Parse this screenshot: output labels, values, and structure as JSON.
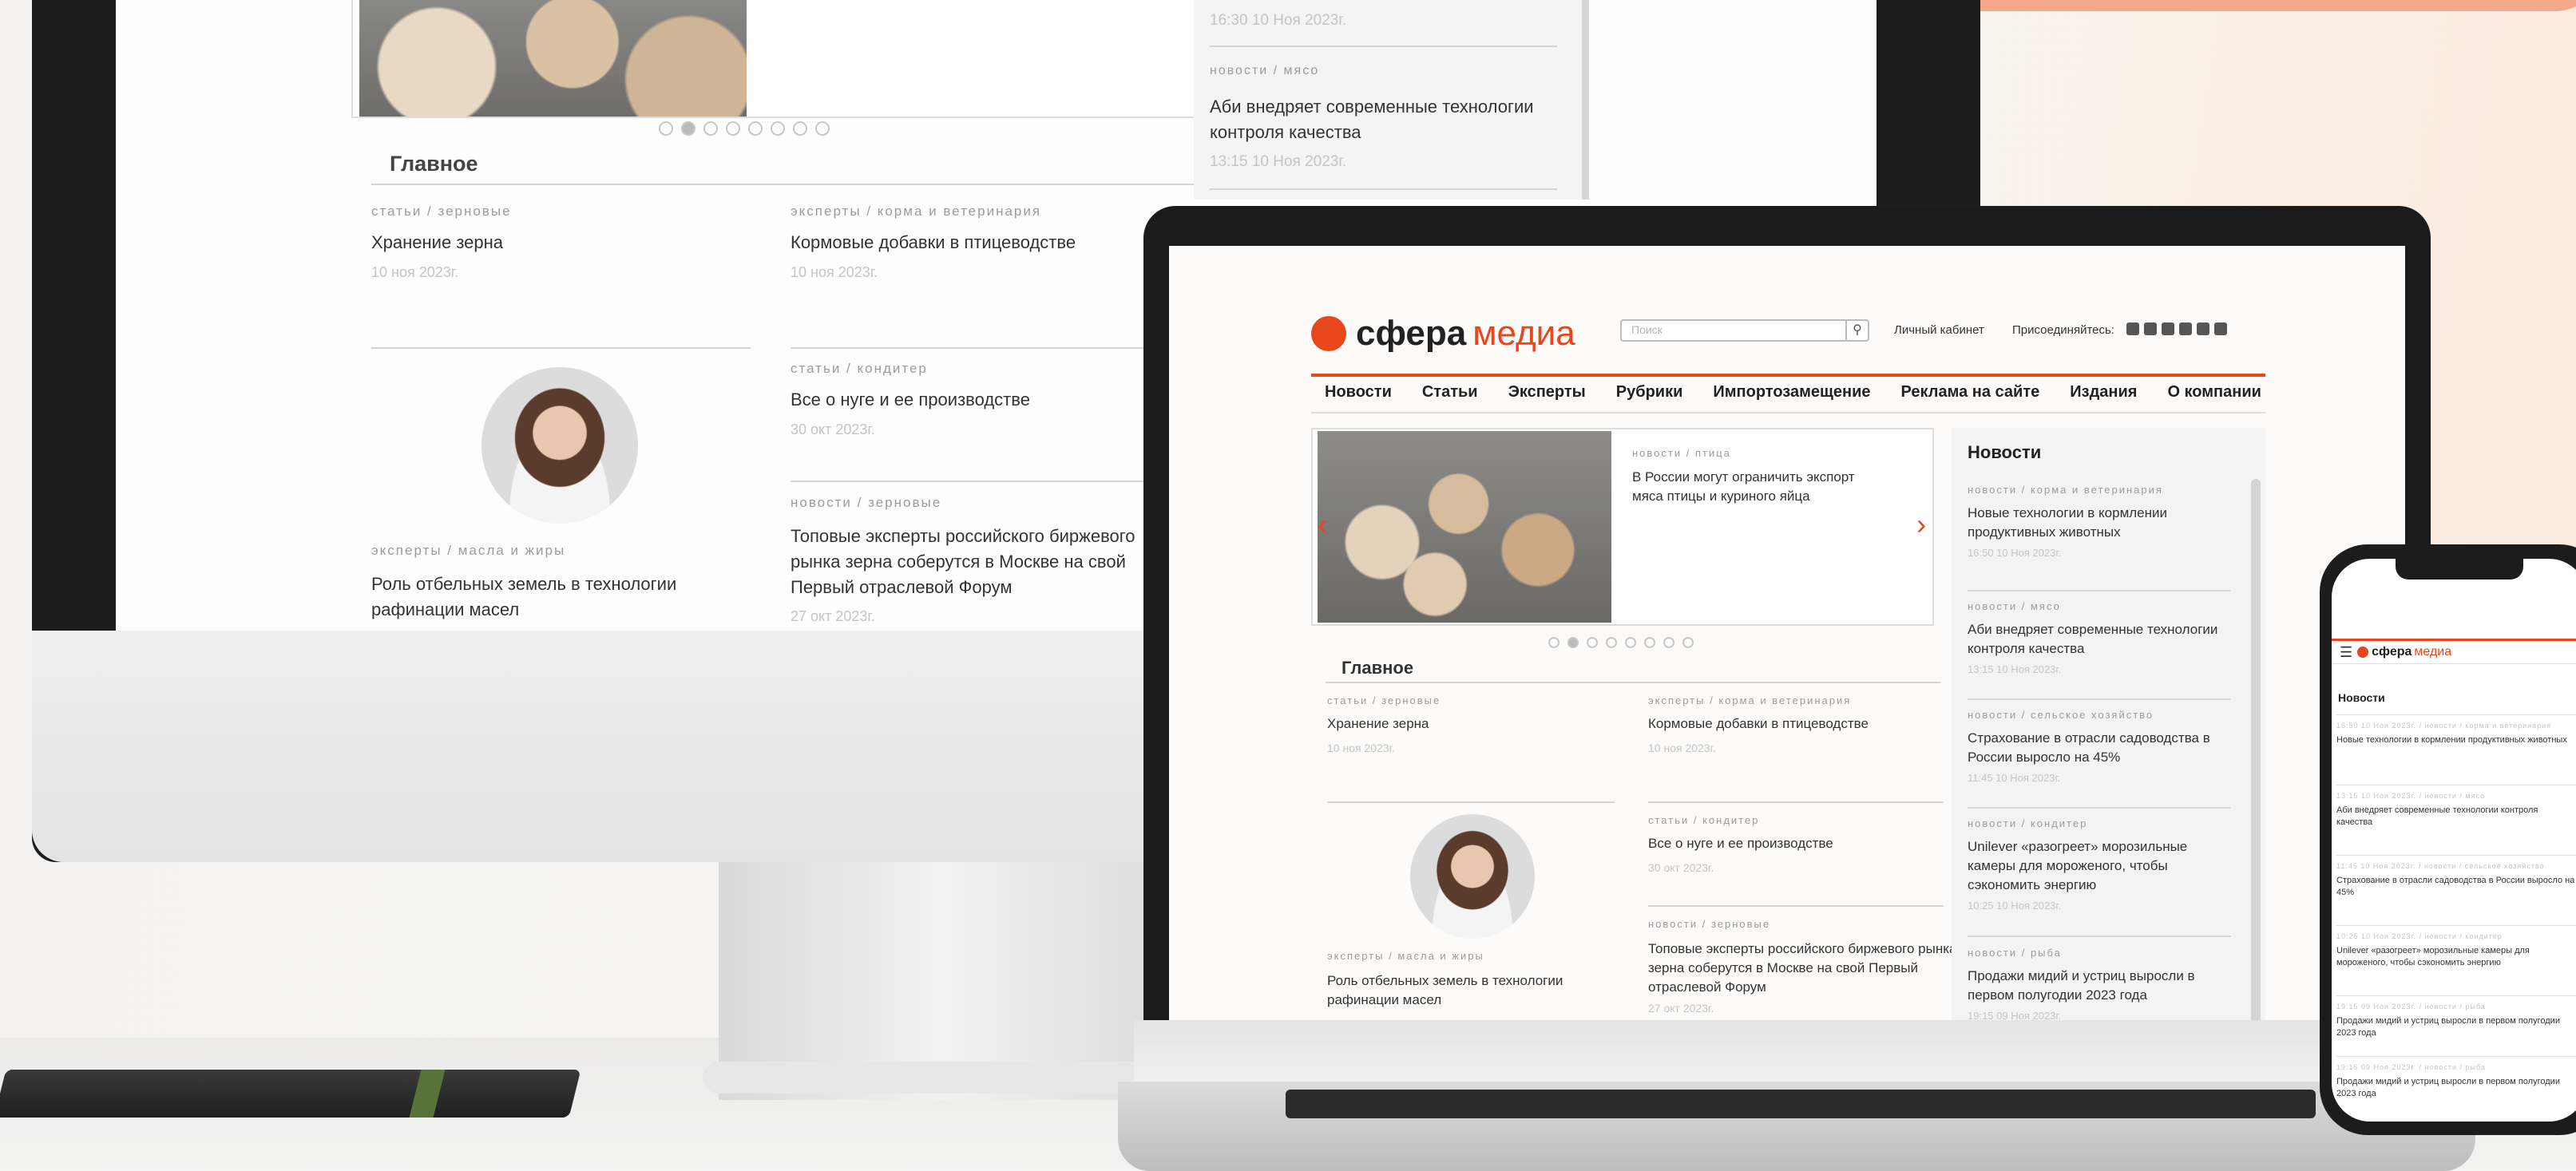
{
  "site": {
    "logo_word1": "сфера",
    "logo_word2": "медиа",
    "brand_color": "#e8471d"
  },
  "header": {
    "search_placeholder": "Поиск",
    "cabinet": "Личный кабинет",
    "join": "Присоединяйтесь:"
  },
  "nav": [
    "Новости",
    "Статьи",
    "Эксперты",
    "Рубрики",
    "Импортозамещение",
    "Реклама на сайте",
    "Издания",
    "О компании"
  ],
  "slider": {
    "category": "новости / птица",
    "title": "В России могут ограничить экспорт мяса птицы и куриного яйца",
    "dots": 8,
    "active_dot": 1
  },
  "main": {
    "heading": "Главное",
    "items": [
      {
        "cat": "статьи / зерновые",
        "title": "Хранение зерна",
        "date": "10 ноя 2023г."
      },
      {
        "cat": "эксперты / корма и ветеринария",
        "title": "Кормовые добавки в птицеводстве",
        "date": "10 ноя 2023г."
      },
      {
        "cat": "статьи / кондитер",
        "title": "Все о нуге и ее производстве",
        "date": "30 окт 2023г."
      },
      {
        "cat": "новости / зерновые",
        "title": "Топовые эксперты российского биржевого рынка зерна соберутся в Москве на свой Первый отраслевой Форум",
        "date": "27 окт 2023г."
      },
      {
        "cat": "эксперты / масла и жиры",
        "title": "Роль отбельных земель в технологии рафинации масел"
      }
    ]
  },
  "news": {
    "heading": "Новости",
    "items": [
      {
        "cat": "новости / корма и ветеринария",
        "title": "Новые технологии в кормлении продуктивных животных",
        "date": "16:50 10 Ноя 2023г."
      },
      {
        "cat": "новости / мясо",
        "title": "Аби внедряет современные технологии контроля качества",
        "date": "13:15 10 Ноя 2023г."
      },
      {
        "cat": "новости / сельское хозяйство",
        "title": "Страхование в отрасли садоводства в России выросло на 45%",
        "date": "11:45 10 Ноя 2023г."
      },
      {
        "cat": "новости / кондитер",
        "title": "Unilever «разогреет» морозильные камеры для мороженого, чтобы сэкономить энергию",
        "date": "10:25 10 Ноя 2023г."
      },
      {
        "cat": "новости / рыба",
        "title": "Продажи мидий и устриц выросли в первом полугодии 2023 года",
        "date": "19:15 09 Ноя 2023г."
      }
    ]
  },
  "monitor_side": {
    "date_top": "16:30 10 Ноя 2023г.",
    "cat": "новости / мясо",
    "title": "Аби внедряет современные технологии контроля качества",
    "date": "13:15 10 Ноя 2023г."
  },
  "phone": {
    "heading": "Новости",
    "items": [
      {
        "meta": "16:50 10 Ноя 2023г. / новости / корма и ветеринария",
        "title": "Новые технологии в кормлении продуктивных животных"
      },
      {
        "meta": "13:15 10 Ноя 2023г. / новости / мясо",
        "title": "Аби внедряет современные технологии контроля качества"
      },
      {
        "meta": "11:45 10 Ноя 2023г. / новости / сельское хозяйство",
        "title": "Страхование в отрасли садоводства в России выросло на 45%"
      },
      {
        "meta": "10:25 10 Ноя 2023г. / новости / кондитер",
        "title": "Unilever «разогреет» морозильные камеры для мороженого, чтобы сэкономить энергию"
      },
      {
        "meta": "19:15 09 Ноя 2023г. / новости / рыба",
        "title": "Продажи мидий и устриц выросли в первом полугодии 2023 года"
      },
      {
        "meta": "19:15 09 Ноя 2023г. / новости / рыба",
        "title": "Продажи мидий и устриц выросли в первом полугодии 2023 года"
      }
    ]
  },
  "icons": {
    "search": "search-icon",
    "arrow_left": "chevron-left-icon",
    "arrow_right": "chevron-right-icon",
    "menu": "hamburger-icon"
  }
}
